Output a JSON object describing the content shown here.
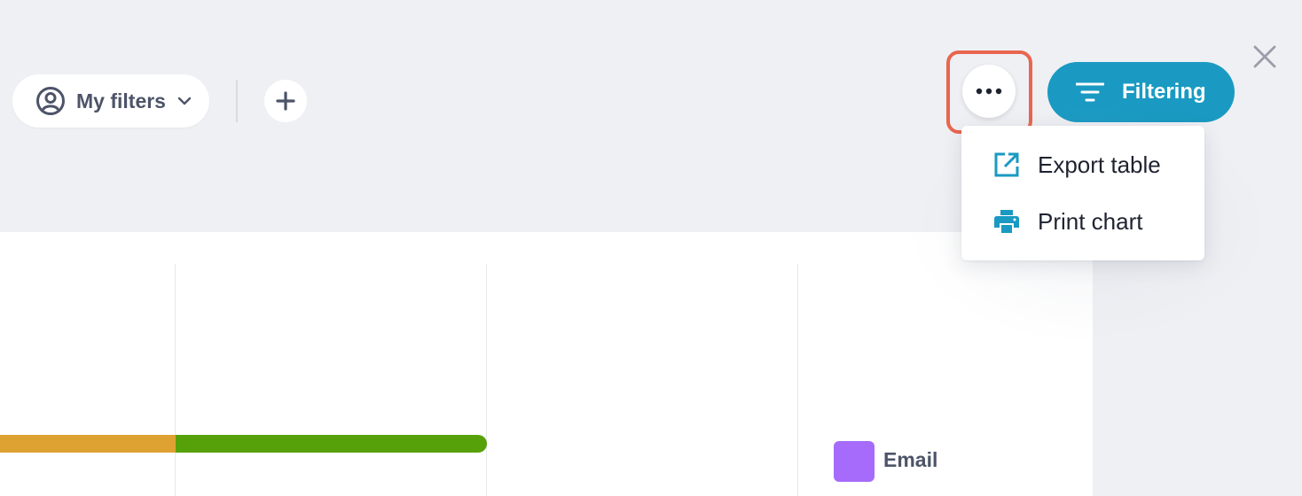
{
  "toolbar": {
    "my_filters_label": "My filters",
    "filtering_label": "Filtering"
  },
  "menu": {
    "items": [
      {
        "label": "Export table",
        "icon": "export-icon"
      },
      {
        "label": "Print chart",
        "icon": "printer-icon"
      }
    ]
  },
  "chart": {
    "legend": [
      {
        "label": "Email",
        "color": "#a66bfa"
      }
    ],
    "visible_bar_colors": [
      "#dea232",
      "#56a10a"
    ]
  },
  "colors": {
    "accent": "#1a9ac2",
    "highlight": "#e8664f",
    "background": "#eff0f4"
  }
}
